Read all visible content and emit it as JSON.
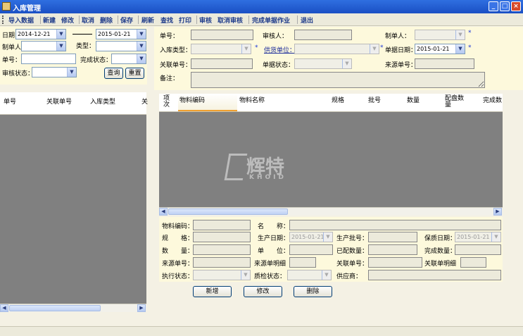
{
  "window": {
    "title": "入库管理",
    "min": "_",
    "max": "□",
    "close": "×"
  },
  "toolbar": [
    "导入数据",
    "新建",
    "修改",
    "取消",
    "删除",
    "保存",
    "刷新",
    "查找",
    "打印",
    "审核",
    "取消审核",
    "完成单据作业",
    "退出"
  ],
  "filter": {
    "date_label": "日期",
    "date_from": "2014-12-21",
    "date_to": "2015-01-21",
    "maker_label": "制单人",
    "type_label": "类型：",
    "no_label": "单号：",
    "done_label": "完成状态：",
    "audit_label": "审核状态：",
    "query": "查询",
    "reset": "重置"
  },
  "left_grid": {
    "headers": [
      "单号",
      "关联单号",
      "入库类型",
      "关"
    ]
  },
  "header_form": {
    "no_label": "单号：",
    "auditor_label": "审核人：",
    "maker_label": "制单人：",
    "type_label": "入库类型：",
    "supplier_label": "供货单位：",
    "date_label": "单据日期：",
    "date_value": "2015-01-21",
    "rel_no_label": "关联单号：",
    "status_label": "单据状态：",
    "source_label": "来源单号：",
    "remark_label": "备注："
  },
  "detail_grid": {
    "headers": [
      "项次",
      "物料编码",
      "物料名称",
      "规格",
      "批号",
      "数量",
      "配盘数量",
      "完成数"
    ]
  },
  "watermark": {
    "brand": "辉特",
    "latin": "KHOID"
  },
  "detail_form": {
    "code_label": "物料编码：",
    "name_label": "名　　称：",
    "spec_label": "规　　格：",
    "prod_date_label": "生产日期：",
    "prod_date_value": "2015-01-21",
    "prod_batch_label": "生产批号：",
    "expiry_label": "保质日期：",
    "expiry_value": "2015-01-21",
    "qty_label": "数　　量：",
    "unit_label": "单　　位：",
    "alloc_label": "已配数量：",
    "done_qty_label": "完成数量：",
    "source_no_label": "来源单号：",
    "source_detail_label": "来源单明细",
    "rel_no_label": "关联单号：",
    "rel_detail_label": "关联单明细",
    "exec_label": "执行状态：",
    "qc_label": "质检状态：",
    "supplier_label": "供应商："
  },
  "actions": {
    "add": "新增",
    "edit": "修改",
    "delete": "删除"
  },
  "icons": {
    "star": "*",
    "arrow": "▼",
    "left": "◀",
    "right": "▶"
  }
}
